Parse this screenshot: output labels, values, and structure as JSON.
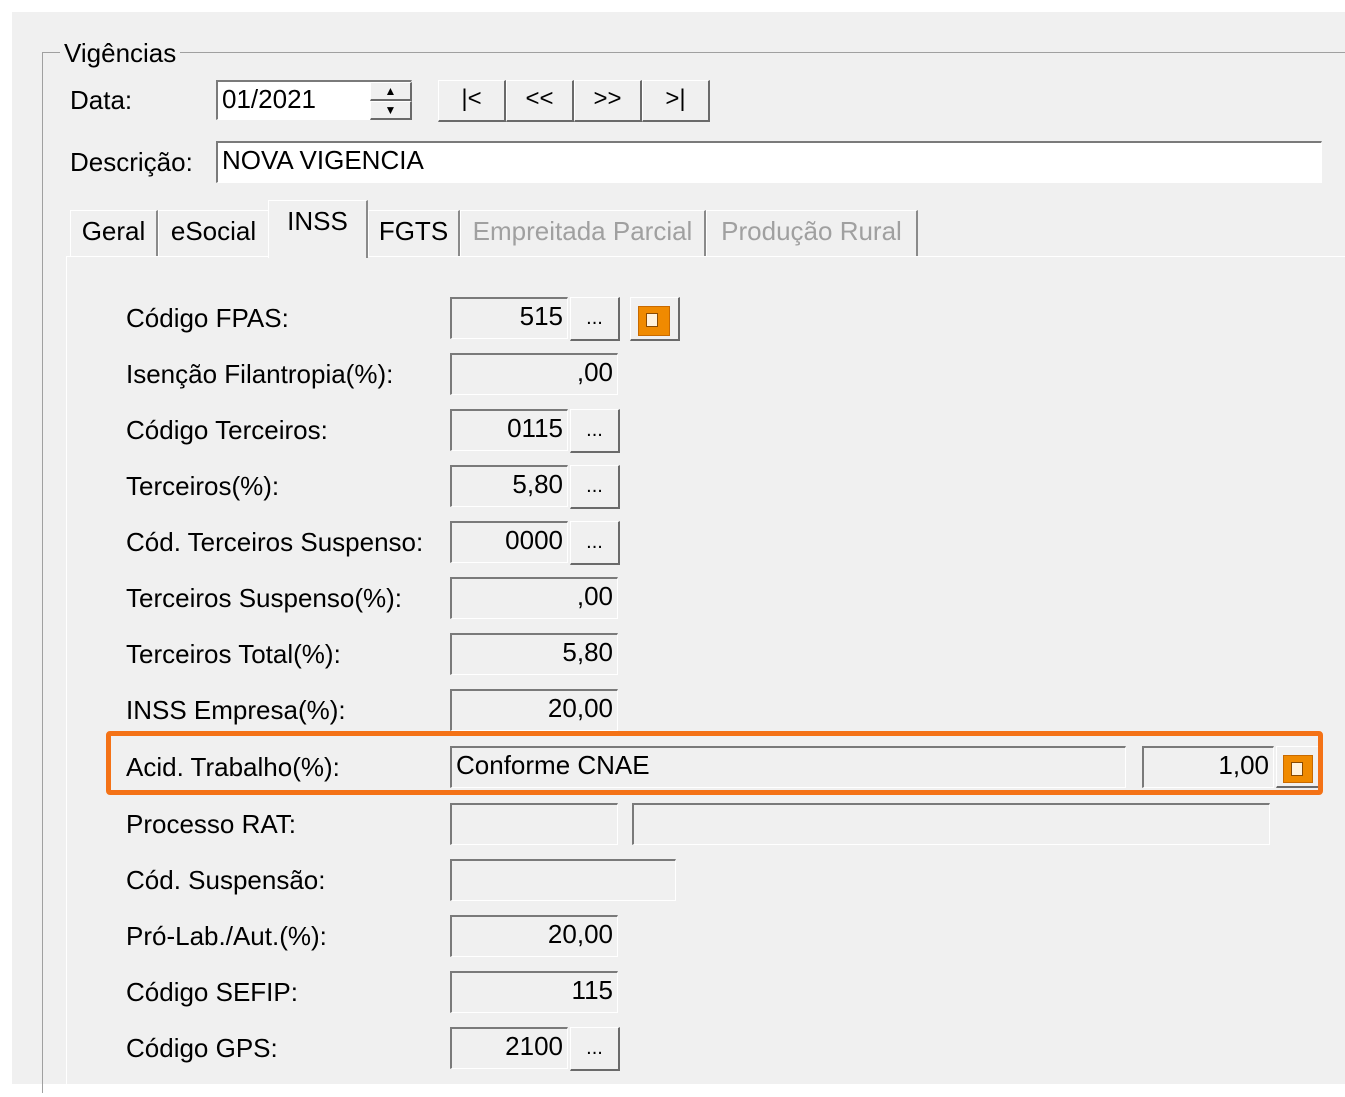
{
  "group": {
    "title": "Vigências"
  },
  "data": {
    "label": "Data:",
    "value": "01/2021"
  },
  "nav": {
    "first": "|<",
    "prev": "<<",
    "next": ">>",
    "last": ">|"
  },
  "descricao": {
    "label": "Descrição:",
    "value": "NOVA VIGENCIA"
  },
  "tabs": [
    {
      "label": "Geral"
    },
    {
      "label": "eSocial"
    },
    {
      "label": "INSS"
    },
    {
      "label": "FGTS"
    },
    {
      "label": "Empreitada Parcial"
    },
    {
      "label": "Produção Rural"
    }
  ],
  "form": {
    "codigo_fpas": {
      "label": "Código FPAS:",
      "value": "515"
    },
    "isencao_filantropia": {
      "label": "Isenção Filantropia(%):",
      "value": ",00"
    },
    "codigo_terceiros": {
      "label": "Código Terceiros:",
      "value": "0115"
    },
    "terceiros": {
      "label": "Terceiros(%):",
      "value": "5,80"
    },
    "cod_terceiros_suspenso": {
      "label": "Cód. Terceiros Suspenso:",
      "value": "0000"
    },
    "terceiros_suspenso": {
      "label": "Terceiros Suspenso(%):",
      "value": ",00"
    },
    "terceiros_total": {
      "label": "Terceiros Total(%):",
      "value": "5,80"
    },
    "inss_empresa": {
      "label": "INSS Empresa(%):",
      "value": "20,00"
    },
    "acid_trabalho": {
      "label": "Acid. Trabalho(%):",
      "mode": "Conforme CNAE",
      "value": "1,00"
    },
    "processo_rat": {
      "label": "Processo RAT:",
      "value": "",
      "desc": ""
    },
    "cod_suspensao": {
      "label": "Cód. Suspensão:",
      "value": ""
    },
    "pro_lab_aut": {
      "label": "Pró-Lab./Aut.(%):",
      "value": "20,00"
    },
    "codigo_sefip": {
      "label": "Código SEFIP:",
      "value": "115"
    },
    "codigo_gps": {
      "label": "Código GPS:",
      "value": "2100"
    }
  },
  "lookup_button": "...",
  "colors": {
    "highlight": "#f47216",
    "icon_orange": "#f08a00",
    "window_bg": "#f0f0f0"
  }
}
